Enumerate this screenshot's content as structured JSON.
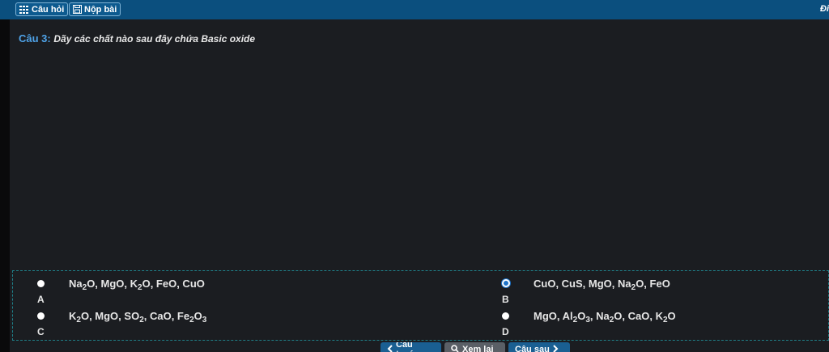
{
  "topbar": {
    "questions_label": "Câu hỏi",
    "submit_label": "Nộp bài",
    "right_text": "Đi"
  },
  "question": {
    "number_label": "Câu 3:",
    "text": "Dãy các chất nào sau đây chứa Basic oxide"
  },
  "options": [
    {
      "letter": "A",
      "selected": false,
      "parts": [
        [
          "Na",
          ""
        ],
        [
          "2",
          "sub"
        ],
        [
          "O, MgO, K",
          ""
        ],
        [
          "2",
          "sub"
        ],
        [
          "O, FeO, CuO",
          ""
        ]
      ]
    },
    {
      "letter": "B",
      "selected": true,
      "parts": [
        [
          "CuO, CuS, MgO, Na",
          ""
        ],
        [
          "2",
          "sub"
        ],
        [
          "O, FeO",
          ""
        ]
      ]
    },
    {
      "letter": "C",
      "selected": false,
      "parts": [
        [
          "K",
          ""
        ],
        [
          "2",
          "sub"
        ],
        [
          "O, MgO, SO",
          ""
        ],
        [
          "2",
          "sub"
        ],
        [
          ", CaO, Fe",
          ""
        ],
        [
          "2",
          "sub"
        ],
        [
          "O",
          ""
        ],
        [
          "3",
          "sub"
        ]
      ]
    },
    {
      "letter": "D",
      "selected": false,
      "parts": [
        [
          "MgO, Al",
          ""
        ],
        [
          "2",
          "sub"
        ],
        [
          "O",
          ""
        ],
        [
          "3",
          "sub"
        ],
        [
          ", Na",
          ""
        ],
        [
          "2",
          "sub"
        ],
        [
          "O, CaO, K",
          ""
        ],
        [
          "2",
          "sub"
        ],
        [
          "O",
          ""
        ]
      ]
    }
  ],
  "nav": {
    "prev_label": "Câu trước",
    "review_label": "Xem lại",
    "next_label": "Câu sau"
  },
  "colors": {
    "topbar": "#0b4f7e",
    "accent": "#4fa3e8",
    "panel": "#1b1d21",
    "nav_blue": "#1a5f92",
    "nav_gray": "#5a5f66"
  }
}
